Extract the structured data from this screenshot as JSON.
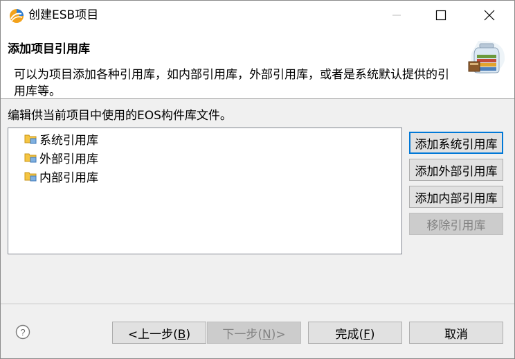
{
  "window": {
    "title": "创建ESB项目",
    "app_icon": "app-logo-icon",
    "controls": [
      "minimize-icon",
      "maximize-icon",
      "close-icon"
    ]
  },
  "banner": {
    "title": "添加项目引用库",
    "description": "可以为项目添加各种引用库，如内部引用库，外部引用库，或者是系统默认提供的引用库等。",
    "image": "library-jar-icon"
  },
  "main": {
    "instruction": "编辑供当前项目中使用的EOS构件库文件。",
    "tree_items": [
      {
        "label": "系统引用库",
        "icon": "library-folder-icon"
      },
      {
        "label": "外部引用库",
        "icon": "library-folder-icon"
      },
      {
        "label": "内部引用库",
        "icon": "library-folder-icon"
      }
    ],
    "buttons": {
      "add_system": "添加系统引用库",
      "add_external": "添加外部引用库",
      "add_internal": "添加内部引用库",
      "remove": "移除引用库"
    }
  },
  "footer": {
    "help_icon": "help-icon",
    "back_pre": "<上一步(",
    "back_key": "B",
    "back_post": ")",
    "next_pre": "下一步(",
    "next_key": "N",
    "next_post": ")>",
    "finish_pre": "完成(",
    "finish_key": "F",
    "finish_post": ")",
    "cancel": "取消"
  },
  "colors": {
    "accent": "#0078d7",
    "disabled_text": "#838383"
  }
}
